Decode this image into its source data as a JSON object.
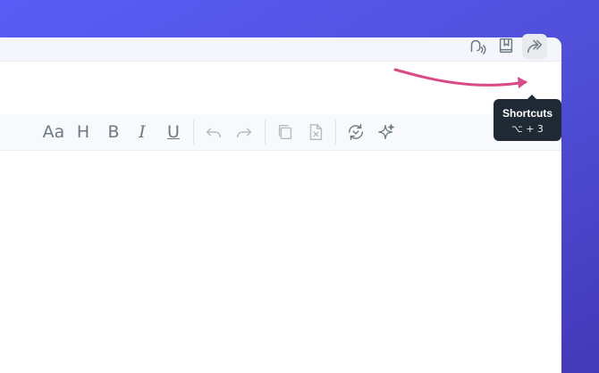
{
  "colors": {
    "background_top": "#5a5cf6",
    "background_bottom": "#4339b8",
    "window": "#ffffff",
    "toolbar": "#f7f9fc",
    "icon": "#6e7a85",
    "tooltip": "#1f2a35",
    "annotation_arrow": "#d94a86"
  },
  "toolbar": {
    "font_label": "Aa",
    "heading_label": "H",
    "bold_label": "B",
    "italic_label": "I",
    "underline_label": "U"
  },
  "icons": {
    "undo": "undo-icon",
    "redo": "redo-icon",
    "copy": "copy-icon",
    "clear": "clear-document-icon",
    "refresh": "refresh-icon",
    "ai": "sparkle-icon",
    "voice": "voice-icon",
    "book": "book-icon",
    "shortcuts": "forward-arrow-icon"
  },
  "tooltip": {
    "title": "Shortcuts",
    "keys": "⌥ + 3"
  }
}
